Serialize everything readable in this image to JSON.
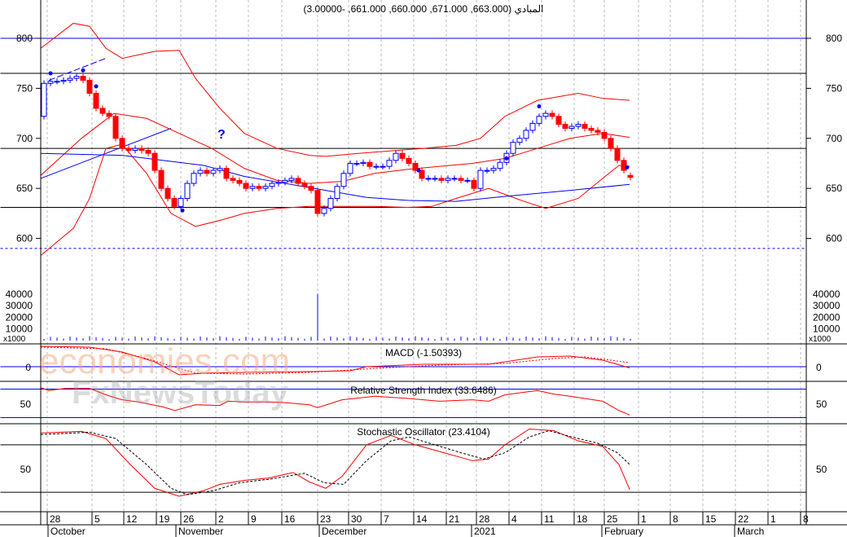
{
  "chart_data": {
    "type": "candlestick",
    "title": "المبادي (663.000, 671.000, 660.000, 661.000, -3.00000)",
    "last_ohlc": {
      "open": 663,
      "high": 671,
      "low": 660,
      "close": 661,
      "change": -3
    },
    "price_axis": {
      "ticks": [
        600,
        650,
        700,
        750,
        800
      ],
      "ylim": [
        575,
        835
      ]
    },
    "closes": [
      755,
      757,
      757,
      758,
      760,
      762,
      758,
      745,
      730,
      725,
      722,
      700,
      690,
      688,
      690,
      688,
      685,
      668,
      650,
      640,
      632,
      640,
      655,
      665,
      668,
      665,
      668,
      670,
      660,
      658,
      655,
      650,
      652,
      650,
      652,
      655,
      656,
      658,
      660,
      655,
      652,
      648,
      625,
      630,
      640,
      652,
      665,
      675,
      675,
      676,
      672,
      672,
      672,
      678,
      685,
      680,
      675,
      668,
      660,
      660,
      660,
      658,
      660,
      660,
      658,
      658,
      650,
      668,
      668,
      670,
      676,
      685,
      696,
      700,
      708,
      715,
      722,
      725,
      722,
      714,
      710,
      712,
      714,
      710,
      708,
      706,
      700,
      690,
      678,
      668,
      661
    ],
    "first_open": 722,
    "bollinger_upper": [
      [
        -0.5,
        790
      ],
      [
        4.5,
        815
      ],
      [
        7,
        812
      ],
      [
        9.5,
        790
      ],
      [
        12,
        780
      ],
      [
        17,
        787
      ],
      [
        20.75,
        788
      ],
      [
        23.25,
        760
      ],
      [
        27,
        730
      ],
      [
        30.75,
        705
      ],
      [
        35.75,
        690
      ],
      [
        40.75,
        683
      ],
      [
        43.25,
        682
      ],
      [
        48.25,
        685
      ],
      [
        58.25,
        690
      ],
      [
        63.25,
        693
      ],
      [
        67,
        700
      ],
      [
        70.75,
        722
      ],
      [
        75.75,
        738
      ],
      [
        82,
        745
      ],
      [
        85.75,
        740
      ],
      [
        89.9,
        738
      ]
    ],
    "bollinger_lower": [
      [
        -0.5,
        583
      ],
      [
        4.5,
        610
      ],
      [
        7,
        640
      ],
      [
        9.5,
        690
      ],
      [
        12,
        694
      ],
      [
        15.75,
        665
      ],
      [
        19.5,
        625
      ],
      [
        23.25,
        612
      ],
      [
        27,
        618
      ],
      [
        30.75,
        625
      ],
      [
        35.75,
        630
      ],
      [
        40.75,
        632
      ],
      [
        45.75,
        632
      ],
      [
        50.75,
        632
      ],
      [
        55.75,
        631
      ],
      [
        59.5,
        632
      ],
      [
        63.25,
        640
      ],
      [
        68.25,
        650
      ],
      [
        73.25,
        638
      ],
      [
        77,
        630
      ],
      [
        82,
        640
      ],
      [
        85.75,
        660
      ],
      [
        88.25,
        673
      ],
      [
        89.9,
        672
      ]
    ],
    "bollinger_middle": [
      [
        -0.5,
        663
      ],
      [
        5.75,
        700
      ],
      [
        10.75,
        725
      ],
      [
        15.75,
        720
      ],
      [
        20.75,
        705
      ],
      [
        25.75,
        690
      ],
      [
        30.75,
        670
      ],
      [
        35.75,
        658
      ],
      [
        40.75,
        655
      ],
      [
        45.75,
        657
      ],
      [
        50.75,
        665
      ],
      [
        55.75,
        669
      ],
      [
        60.75,
        672
      ],
      [
        65.75,
        675
      ],
      [
        70.75,
        680
      ],
      [
        75.75,
        690
      ],
      [
        80.75,
        700
      ],
      [
        85.75,
        705
      ],
      [
        89.9,
        701
      ]
    ],
    "moving_average": [
      [
        -0.5,
        685
      ],
      [
        12,
        683
      ],
      [
        24.5,
        673
      ],
      [
        30.75,
        662
      ],
      [
        37,
        655
      ],
      [
        43.25,
        648
      ],
      [
        49.5,
        641
      ],
      [
        55.75,
        638
      ],
      [
        63.25,
        637
      ],
      [
        70.75,
        642
      ],
      [
        80.75,
        648
      ],
      [
        89.9,
        654
      ]
    ],
    "horizontal_levels": {
      "black": [
        765,
        690,
        631
      ],
      "blue": [
        800
      ],
      "blue_dashed": [
        590
      ]
    },
    "volume": {
      "label": "x1000",
      "ticks": [
        10000,
        20000,
        30000,
        40000
      ],
      "spike_index": 42,
      "spike_value": 40000,
      "typical": 2500
    },
    "macd": {
      "label": "MACD (-1.50393)",
      "tick": "0",
      "line": [
        [
          -0.5,
          25
        ],
        [
          7,
          24
        ],
        [
          12,
          18
        ],
        [
          17,
          6
        ],
        [
          20.75,
          -10
        ],
        [
          24.5,
          -8
        ],
        [
          30.75,
          -7
        ],
        [
          40.75,
          -6
        ],
        [
          47,
          -5
        ],
        [
          49.5,
          0
        ],
        [
          58.25,
          3
        ],
        [
          68.25,
          3
        ],
        [
          75.75,
          12
        ],
        [
          80.75,
          13
        ],
        [
          85.75,
          8
        ],
        [
          89.9,
          -1.5
        ]
      ],
      "signal": [
        [
          -0.5,
          24
        ],
        [
          9.5,
          22
        ],
        [
          15.75,
          10
        ],
        [
          23.25,
          -8
        ],
        [
          30.75,
          -9
        ],
        [
          40.75,
          -7
        ],
        [
          51,
          -2
        ],
        [
          60.75,
          2
        ],
        [
          70.75,
          4
        ],
        [
          78.25,
          10
        ],
        [
          83,
          12
        ],
        [
          89.9,
          5
        ]
      ]
    },
    "rsi": {
      "label": "Relative Strength Index (33.6486)",
      "tick": "50",
      "levels": [
        70,
        30
      ],
      "line": [
        [
          -0.5,
          72
        ],
        [
          0.75,
          68
        ],
        [
          3.25,
          71
        ],
        [
          7,
          71
        ],
        [
          9.5,
          62
        ],
        [
          12,
          55
        ],
        [
          14.5,
          52
        ],
        [
          18.25,
          45
        ],
        [
          20.1,
          40
        ],
        [
          23.25,
          48
        ],
        [
          27,
          47
        ],
        [
          28.25,
          53
        ],
        [
          30.75,
          52
        ],
        [
          34.5,
          52
        ],
        [
          37,
          51
        ],
        [
          40.75,
          48
        ],
        [
          42,
          44
        ],
        [
          45.75,
          55
        ],
        [
          50.75,
          60
        ],
        [
          55.75,
          57
        ],
        [
          60.75,
          53
        ],
        [
          65.75,
          55
        ],
        [
          68.25,
          53
        ],
        [
          70.75,
          62
        ],
        [
          75.75,
          68
        ],
        [
          78.25,
          63
        ],
        [
          80.75,
          60
        ],
        [
          85.75,
          53
        ],
        [
          88.25,
          40
        ],
        [
          89.9,
          33.6
        ]
      ]
    },
    "stochastic": {
      "label": "Stochastic Oscillator (23.4104)",
      "tick": "50",
      "levels": [
        80,
        20
      ],
      "k": [
        [
          -0.5,
          95
        ],
        [
          5.75,
          97
        ],
        [
          9.5,
          88
        ],
        [
          13.25,
          55
        ],
        [
          17,
          25
        ],
        [
          20.75,
          15
        ],
        [
          24.5,
          22
        ],
        [
          27,
          30
        ],
        [
          30.75,
          35
        ],
        [
          34.5,
          38
        ],
        [
          38.25,
          45
        ],
        [
          40.75,
          33
        ],
        [
          43.25,
          25
        ],
        [
          45.75,
          40
        ],
        [
          49.5,
          80
        ],
        [
          53.25,
          92
        ],
        [
          57,
          80
        ],
        [
          61.4,
          70
        ],
        [
          65.75,
          60
        ],
        [
          68.25,
          62
        ],
        [
          70.75,
          80
        ],
        [
          74.5,
          100
        ],
        [
          78.25,
          98
        ],
        [
          82,
          85
        ],
        [
          85.75,
          78
        ],
        [
          88.25,
          55
        ],
        [
          89.9,
          23.4
        ]
      ],
      "d": [
        [
          -0.5,
          93
        ],
        [
          7,
          96
        ],
        [
          11,
          88
        ],
        [
          15.75,
          55
        ],
        [
          19.5,
          25
        ],
        [
          22,
          17
        ],
        [
          26,
          22
        ],
        [
          30,
          32
        ],
        [
          35,
          37
        ],
        [
          40,
          44
        ],
        [
          43,
          32
        ],
        [
          46,
          30
        ],
        [
          49.5,
          60
        ],
        [
          53.25,
          85
        ],
        [
          56,
          90
        ],
        [
          60,
          80
        ],
        [
          64,
          70
        ],
        [
          67.5,
          62
        ],
        [
          70.75,
          70
        ],
        [
          74.5,
          90
        ],
        [
          77.5,
          98
        ],
        [
          81,
          90
        ],
        [
          85,
          82
        ],
        [
          88,
          70
        ],
        [
          89.9,
          55
        ]
      ]
    },
    "x_days": [
      "28",
      "5",
      "12",
      "19",
      "26",
      "2",
      "9",
      "16",
      "23",
      "30",
      "7",
      "14",
      "21",
      "28",
      "4",
      "11",
      "18",
      "25",
      "1",
      "8",
      "15",
      "22",
      "1",
      "8"
    ],
    "x_months": [
      "October",
      "November",
      "December",
      "2021",
      "February",
      "March"
    ]
  },
  "watermark": {
    "brand1": "economies.com",
    "brand2": "FxNewsToday"
  }
}
